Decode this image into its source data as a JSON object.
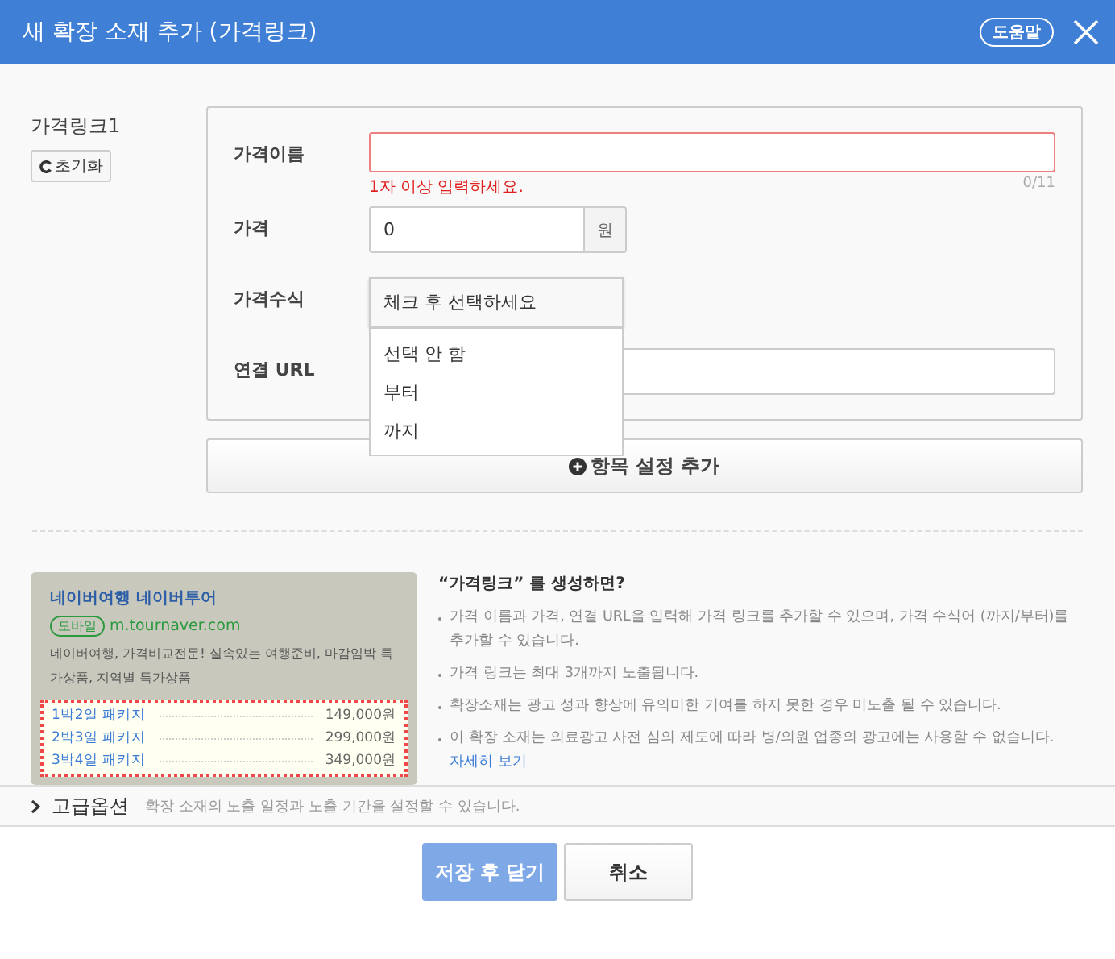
{
  "window": {
    "title": "새 확장 소재 추가 (가격링크)",
    "help_button": "도움말"
  },
  "item": {
    "title": "가격링크1",
    "reset_button": "초기화"
  },
  "form": {
    "name": {
      "label": "가격이름",
      "error": "1자 이상 입력하세요.",
      "counter": "0/11",
      "invalid": true
    },
    "price": {
      "label": "가격",
      "value": "0",
      "unit": "원"
    },
    "modifier": {
      "label": "가격수식",
      "value": "체크 후 선택하세요",
      "expanded": true,
      "options": [
        {
          "label": "선택 안 함",
          "selected": false
        },
        {
          "label": "부터",
          "selected": false
        },
        {
          "label": "까지",
          "selected": false
        }
      ]
    },
    "url": {
      "label": "연결 URL"
    }
  },
  "add_button": "항목 설정 추가",
  "preview": {
    "title": "네이버여행 네이버투어",
    "badge": "모바일",
    "url": "m.tournaver.com",
    "description": "네이버여행, 가격비교전문! 실속있는 여행준비, 마감임박 특가상품, 지역별 특가상품",
    "links": [
      {
        "name": "1박2일 패키지",
        "price": "149,000원"
      },
      {
        "name": "2박3일 패키지",
        "price": "299,000원"
      },
      {
        "name": "3박4일 패키지",
        "price": "349,000원"
      }
    ]
  },
  "help": {
    "title": "“가격링크” 를 생성하면?",
    "bullets": [
      {
        "text": "가격 이름과 가격, 연결 URL을 입력해 가격 링크를 추가할 수 있으며, 가격 수식어 (까지/부터)를 추가할 수 있습니다."
      },
      {
        "text": "가격 링크는 최대 3개까지 노출됩니다."
      },
      {
        "text": "확장소재는 광고 성과 향상에 유의미한 기여를 하지 못한 경우 미노출 될 수 있습니다."
      },
      {
        "text": "이 확장 소재는 의료광고 사전 심의 제도에 따라 병/의원 업종의 광고에는 사용할 수 없습니다.",
        "link": "자세히 보기"
      }
    ]
  },
  "advanced": {
    "title": "고급옵션",
    "description": "확장 소재의 노출 일정과 노출 기간을 설정할 수 있습니다.",
    "expanded": false
  },
  "buttons": [
    {
      "label": "저장 후 닫기",
      "kind": "primary",
      "disabled": true
    },
    {
      "label": "취소",
      "kind": "secondary",
      "disabled": false
    }
  ]
}
